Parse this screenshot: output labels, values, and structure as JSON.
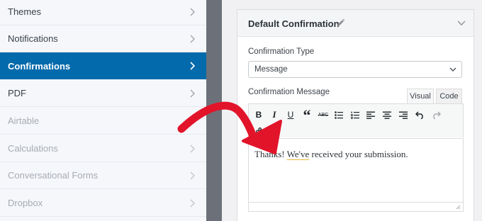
{
  "sidebar": {
    "items": [
      {
        "label": "Themes",
        "state": "normal"
      },
      {
        "label": "Notifications",
        "state": "normal"
      },
      {
        "label": "Confirmations",
        "state": "active"
      },
      {
        "label": "PDF",
        "state": "normal"
      },
      {
        "label": "Airtable",
        "state": "muted"
      },
      {
        "label": "Calculations",
        "state": "muted"
      },
      {
        "label": "Conversational Forms",
        "state": "muted"
      },
      {
        "label": "Dropbox",
        "state": "muted"
      }
    ],
    "icons": {
      "item_chevron": "chevron-right-icon"
    }
  },
  "panel": {
    "title": "Default Confirmation",
    "edit_icon": "pencil-icon",
    "collapse_icon": "chevron-down-icon",
    "type_label": "Confirmation Type",
    "type_value": "Message",
    "message_label": "Confirmation Message",
    "tabs": {
      "visual": "Visual",
      "code": "Code"
    },
    "editor": {
      "text_before": "Thanks! ",
      "text_flagged": "We've",
      "text_after": " received your submission."
    }
  },
  "toolbar": {
    "bold": "B",
    "italic": "I",
    "underline": "U",
    "blockquote": "“",
    "strikethrough": "ABC",
    "icons": [
      "bold-icon",
      "italic-icon",
      "underline-icon",
      "blockquote-icon",
      "strikethrough-icon",
      "bullet-list-icon",
      "numbered-list-icon",
      "align-left-icon",
      "align-center-icon",
      "align-right-icon",
      "undo-icon",
      "redo-icon",
      "link-icon",
      "smart-tags-icon"
    ]
  },
  "colors": {
    "active_bg": "#036aab",
    "arrow": "#e2142a",
    "band": "#6c7179"
  }
}
